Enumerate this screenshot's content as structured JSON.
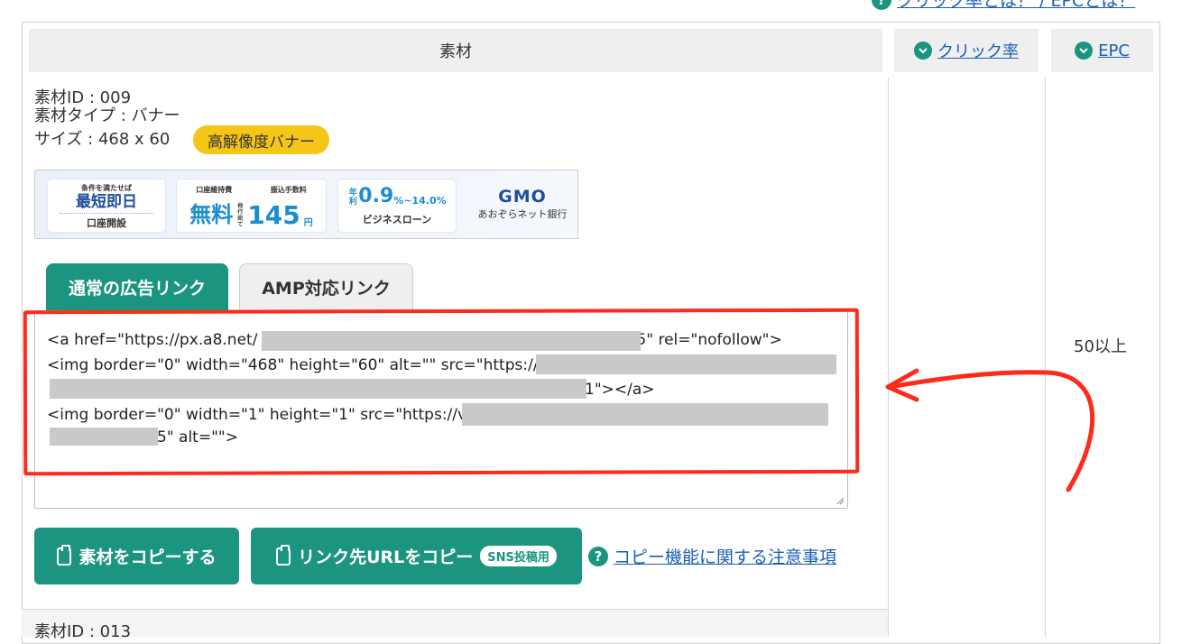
{
  "header": {
    "help_link": "クリック率とは？ / EPCとは？",
    "col_material": "素材",
    "col_click_rate": "クリック率",
    "col_epc": "EPC"
  },
  "material": {
    "id_line": "素材ID : 009",
    "type_line": "素材タイプ : バナー",
    "size_line": "サイズ : 468 x 60",
    "badge": "高解像度バナー"
  },
  "banner": {
    "box1_small": "条件を満たせば",
    "box1_big": "最短即日",
    "box1_sub": "口座開設",
    "box2_small_a": "口座維持費",
    "box2_small_b": "振込手数料",
    "box2_big_a": "無料",
    "box2_tiny": "他行宛て",
    "box2_big_b": "145",
    "box2_unit": "円",
    "box3_prefix": "年利",
    "box3_rate": "0.9",
    "box3_rest": "%~14.0%",
    "box3_sub": "ビジネスローン",
    "logo_main": "GMO",
    "logo_sub": "あおぞらネット銀行"
  },
  "tabs": {
    "normal": "通常の広告リンク",
    "amp": "AMP対応リンク"
  },
  "code": {
    "l1a": "<a href=\"https://px.a8.net/",
    "l1b": "5\" rel=\"nofollow\">",
    "l2a": "<img border=\"0\" width=\"468\" height=\"60\" alt=\"\" src=\"https://",
    "l3b": "1\"></a>",
    "l4a": "<img border=\"0\" width=\"1\" height=\"1\" src=\"https://v",
    "l5b": "5\" alt=\"\">"
  },
  "buttons": {
    "copy_material": "素材をコピーする",
    "copy_url": "リンク先URLをコピー",
    "sns_badge": "SNS投稿用",
    "note_link": "コピー機能に関する注意事項"
  },
  "epc_value": "50以上",
  "next_row_label": "素材ID : 013",
  "colors": {
    "accent": "#1b9580",
    "badge": "#f5c518",
    "highlight": "#ff2a1a",
    "link": "#1a5fb4"
  }
}
